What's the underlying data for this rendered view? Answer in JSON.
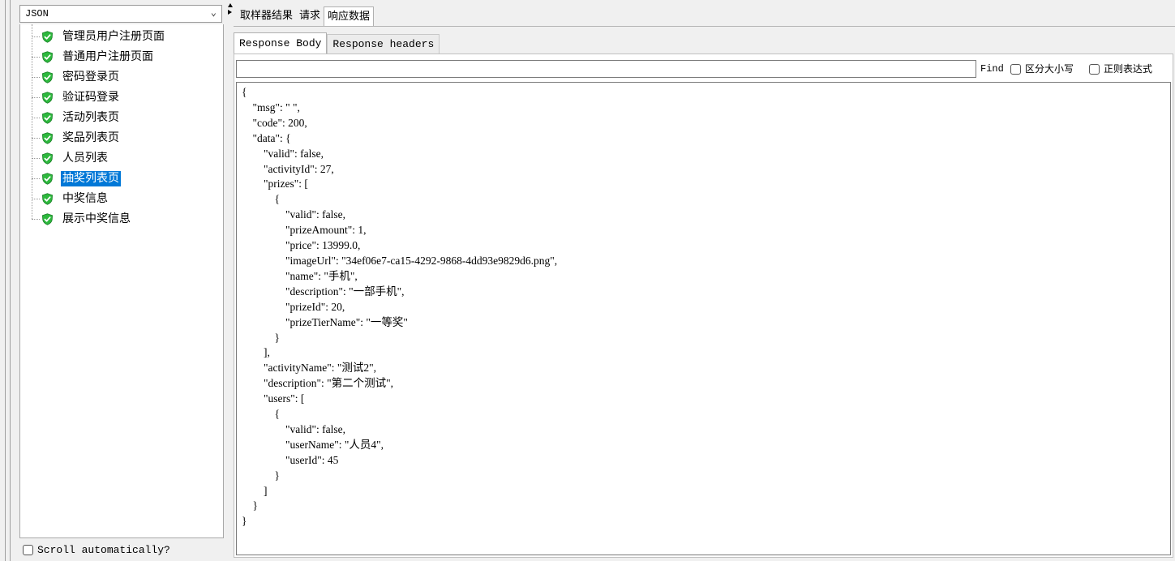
{
  "renderer": {
    "selected": "JSON"
  },
  "tree": {
    "items": [
      {
        "label": "管理员用户注册页面",
        "status": "success",
        "selected": false
      },
      {
        "label": "普通用户注册页面",
        "status": "success",
        "selected": false
      },
      {
        "label": "密码登录页",
        "status": "success",
        "selected": false
      },
      {
        "label": "验证码登录",
        "status": "success",
        "selected": false
      },
      {
        "label": "活动列表页",
        "status": "success",
        "selected": false
      },
      {
        "label": "奖品列表页",
        "status": "success",
        "selected": false
      },
      {
        "label": "人员列表",
        "status": "success",
        "selected": false
      },
      {
        "label": "抽奖列表页",
        "status": "success",
        "selected": true
      },
      {
        "label": "中奖信息",
        "status": "success",
        "selected": false
      },
      {
        "label": "展示中奖信息",
        "status": "success",
        "selected": false
      }
    ]
  },
  "scroll_auto": {
    "label": "Scroll automatically?",
    "checked": false
  },
  "tabs": {
    "main": [
      {
        "label": "取样器结果",
        "active": false
      },
      {
        "label": "请求",
        "active": false
      },
      {
        "label": "响应数据",
        "active": true
      }
    ],
    "sub": [
      {
        "label": "Response Body",
        "active": true
      },
      {
        "label": "Response headers",
        "active": false
      }
    ]
  },
  "search": {
    "value": "",
    "find_label": "Find",
    "case_label": "区分大小写",
    "regex_label": "正则表达式",
    "case_checked": false,
    "regex_checked": false
  },
  "response": {
    "body": "{\n    \"msg\": \" \",\n    \"code\": 200,\n    \"data\": {\n        \"valid\": false,\n        \"activityId\": 27,\n        \"prizes\": [\n            {\n                \"valid\": false,\n                \"prizeAmount\": 1,\n                \"price\": 13999.0,\n                \"imageUrl\": \"34ef06e7-ca15-4292-9868-4dd93e9829d6.png\",\n                \"name\": \"手机\",\n                \"description\": \"一部手机\",\n                \"prizeId\": 20,\n                \"prizeTierName\": \"一等奖\"\n            }\n        ],\n        \"activityName\": \"测试2\",\n        \"description\": \"第二个测试\",\n        \"users\": [\n            {\n                \"valid\": false,\n                \"userName\": \"人员4\",\n                \"userId\": 45\n            }\n        ]\n    }\n}"
  },
  "colors": {
    "selection": "#0078d7",
    "success_icon": "#2db83d"
  }
}
